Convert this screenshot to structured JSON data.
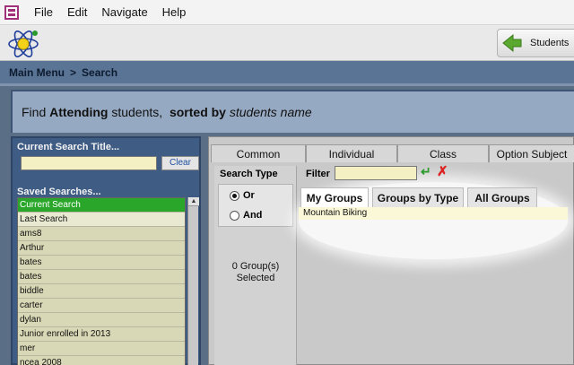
{
  "menu": {
    "items": [
      "File",
      "Edit",
      "Navigate",
      "Help"
    ]
  },
  "toolbar": {
    "students_label": "Students"
  },
  "breadcrumb": {
    "main": "Main Menu",
    "separator": ">",
    "current": "Search"
  },
  "header": {
    "prefix": "Find",
    "status": "Attending",
    "middle": "students,",
    "sorted_label": "sorted by",
    "sort_field": "students name"
  },
  "left_panel": {
    "current_search_title": "Current Search Title...",
    "clear_label": "Clear",
    "saved_searches_title": "Saved Searches...",
    "saved_searches": [
      "Current Search",
      "Last Search",
      "ams8",
      "Arthur",
      "bates",
      "bates",
      "biddle",
      "carter",
      "dylan",
      "Junior enrolled in 2013",
      "mer",
      "ncea 2008"
    ]
  },
  "right_panel": {
    "tabs": [
      "Common",
      "Individual",
      "Class",
      "Option Subject"
    ],
    "search_type_label": "Search Type",
    "radio_or": "Or",
    "radio_and": "And",
    "selected_radio": "Or",
    "group_count_line1": "0 Group(s)",
    "group_count_line2": "Selected",
    "filter_label": "Filter",
    "filter_value": "",
    "group_tabs": [
      "My Groups",
      "Groups by Type",
      "All Groups"
    ],
    "active_group_tab": "My Groups",
    "groups": [
      "Mountain Biking"
    ]
  },
  "colors": {
    "current_search_row": "#2aa72a",
    "input_background": "#f5efc4",
    "enter_icon": "#2a9a2a",
    "clear_filter_icon": "#d22222"
  }
}
